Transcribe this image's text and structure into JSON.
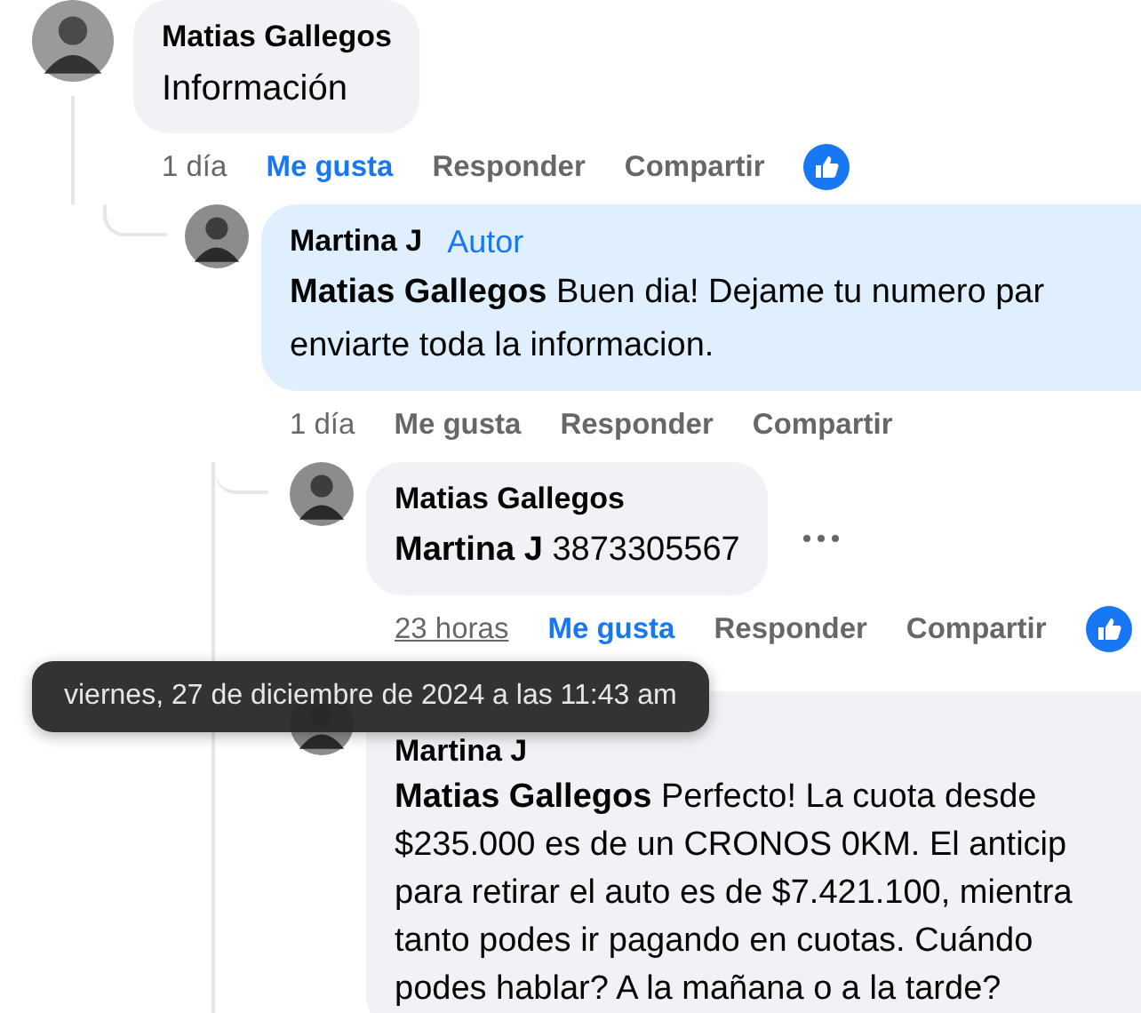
{
  "comments": [
    {
      "author": "Matias Gallegos",
      "lines": [
        "Información"
      ],
      "time": "1 día",
      "time_hovered": false,
      "like": "Me gusta",
      "liked": true,
      "reply": "Responder",
      "share": "Compartir",
      "reacted": true,
      "children": [
        {
          "author": "Martina J",
          "badge": "Autor",
          "highlighted": true,
          "mention": "Matias Gallegos",
          "lines": [
            "Buen dia! Dejame tu numero par",
            "enviarte toda la informacion."
          ],
          "time": "1 día",
          "time_hovered": false,
          "like": "Me gusta",
          "liked": false,
          "reply": "Responder",
          "share": "Compartir"
        },
        {
          "author": "Matias Gallegos",
          "mention": "Martina J",
          "lines": [
            "3873305567"
          ],
          "time": "23 horas",
          "time_hovered": true,
          "like": "Me gusta",
          "liked": true,
          "reply": "Responder",
          "share": "Compartir",
          "reacted": true,
          "more": true
        },
        {
          "author": "Martina J",
          "mention": "Matias Gallegos",
          "lines": [
            "Perfecto! La cuota desde",
            "$235.000 es de un CRONOS 0KM. El anticip",
            "para retirar el auto es de $7.421.100, mientra",
            "tanto podes ir pagando en cuotas. Cuándo",
            "podes hablar? A la mañana o a la tarde?"
          ]
        }
      ]
    }
  ],
  "tooltip": {
    "text": "viernes, 27 de diciembre de 2024 a las 11:43 am"
  }
}
